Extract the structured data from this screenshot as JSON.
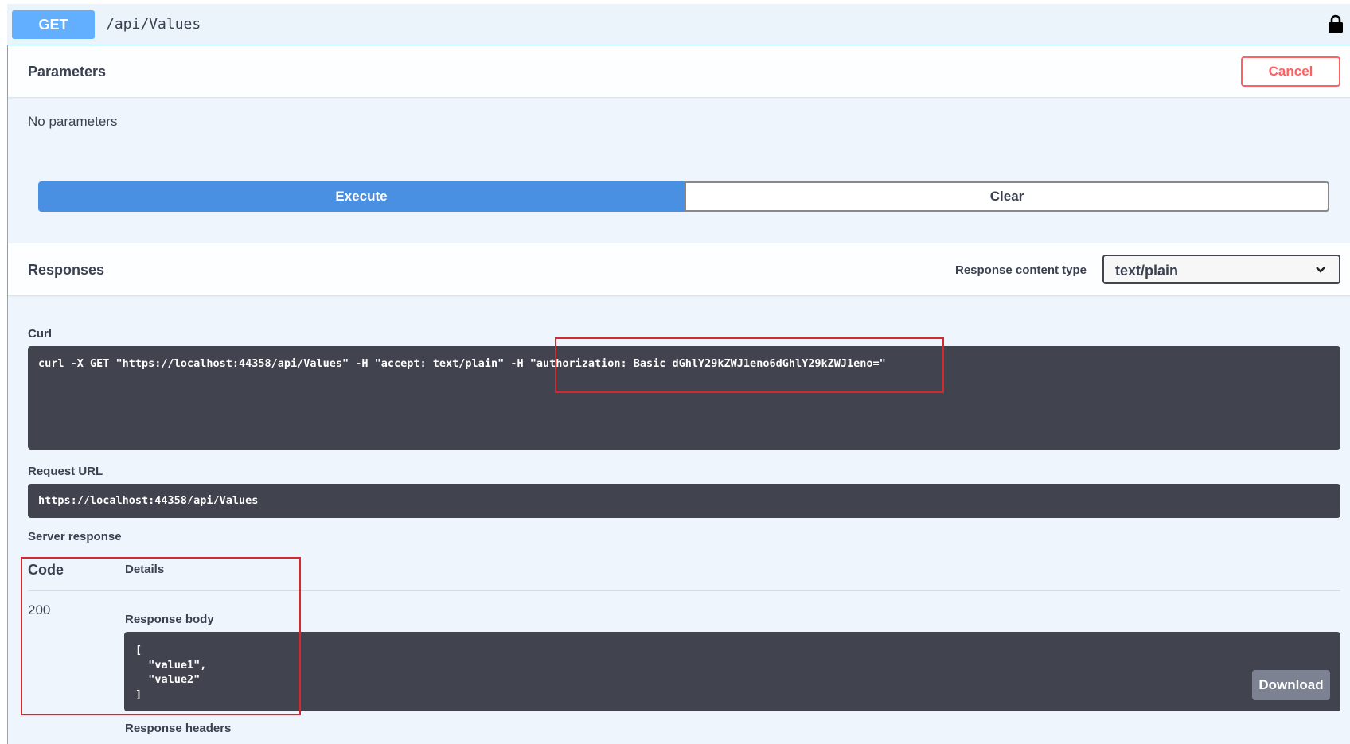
{
  "header": {
    "method": "GET",
    "path": "/api/Values",
    "lock_icon": "lock-icon"
  },
  "parameters": {
    "title": "Parameters",
    "cancel_label": "Cancel",
    "empty_text": "No parameters"
  },
  "actions": {
    "execute_label": "Execute",
    "clear_label": "Clear"
  },
  "responses": {
    "title": "Responses",
    "content_type_label": "Response content type",
    "content_type_value": "text/plain"
  },
  "curl": {
    "label": "Curl",
    "command_prefix": "curl -X GET \"https://localhost:44358/api/Values\" -H \"accept: text/plain\" -H ",
    "command_auth": "\"authorization: Basic dGhlY29kZWJ1eno6dGhlY29kZWJ1eno=\""
  },
  "request_url": {
    "label": "Request URL",
    "value": "https://localhost:44358/api/Values"
  },
  "server_response": {
    "label": "Server response",
    "code_header": "Code",
    "details_header": "Details",
    "code": "200",
    "body_label": "Response body",
    "body": "[\n  \"value1\",\n  \"value2\"\n]",
    "download_label": "Download",
    "headers_label": "Response headers"
  },
  "colors": {
    "get": "#61affe",
    "execute": "#4990e2",
    "cancel": "#ff6060",
    "highlight": "#d9272e",
    "code_bg": "#41444e"
  }
}
